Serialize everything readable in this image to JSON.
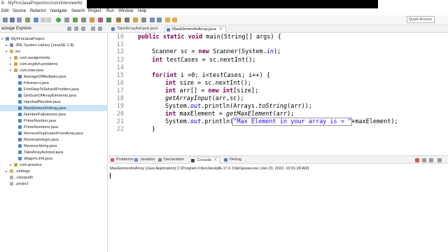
{
  "window": {
    "title": "B - MyFirstJavaProject/src/com/interview/M"
  },
  "menu": [
    "Edit",
    "Source",
    "Refactor",
    "Navigate",
    "Search",
    "Project",
    "Run",
    "Window",
    "Help"
  ],
  "toolbar": {
    "quick_access": "Quick Access"
  },
  "package_explorer": {
    "title": "ackage Explorer",
    "items": [
      {
        "label": "MyFirstJavaProject",
        "icon": "project-icon",
        "level": 0,
        "expanded": true
      },
      {
        "label": "JRE System Library [JavaSE-1.8]",
        "icon": "library-icon",
        "level": 1,
        "expanded": false
      },
      {
        "label": "src",
        "icon": "folder-icon",
        "level": 1,
        "expanded": true
      },
      {
        "label": "com.assignments",
        "icon": "package-icon",
        "level": 2,
        "expanded": false
      },
      {
        "label": "com.english.problems",
        "icon": "package-icon",
        "level": 2,
        "expanded": false
      },
      {
        "label": "com.interview",
        "icon": "package-icon",
        "level": 2,
        "expanded": true
      },
      {
        "label": "AverageOfMultiples.java",
        "icon": "java-file-icon",
        "level": 3
      },
      {
        "label": "Fibonacci.java",
        "icon": "java-file-icon",
        "level": 3
      },
      {
        "label": "FirstStepToSolveAProblem.java",
        "icon": "java-file-icon",
        "level": 3
      },
      {
        "label": "GetSumOfArrayElements.java",
        "icon": "java-file-icon",
        "level": 3
      },
      {
        "label": "HarshadNumber.java",
        "icon": "java-file-icon",
        "level": 3
      },
      {
        "label": "MaxElementInArray.java",
        "icon": "java-file-icon",
        "level": 3,
        "selected": true
      },
      {
        "label": "NumberPalindrome.java",
        "icon": "java-file-icon",
        "level": 3
      },
      {
        "label": "PrimeNumber.java",
        "icon": "java-file-icon",
        "level": 3
      },
      {
        "label": "PrimeNumbers.java",
        "icon": "java-file-icon",
        "level": 3
      },
      {
        "label": "RemoveDuplicatesFromArray.java",
        "icon": "java-file-icon",
        "level": 3
      },
      {
        "label": "ReverseInteger.java",
        "icon": "java-file-icon",
        "level": 3
      },
      {
        "label": "ReverseString.java",
        "icon": "java-file-icon",
        "level": 3
      },
      {
        "label": "TakeArrayAsInput.java",
        "icon": "java-file-icon",
        "level": 3
      },
      {
        "label": "WagonLimit.java",
        "icon": "java-file-icon",
        "level": 3
      },
      {
        "label": "com.practice",
        "icon": "package-icon",
        "level": 2,
        "expanded": false
      },
      {
        "label": ".settings",
        "icon": "folder-icon",
        "level": 1,
        "expanded": false
      },
      {
        "label": ".classpath",
        "icon": "file-icon",
        "level": 1
      },
      {
        "label": ".project",
        "icon": "file-icon",
        "level": 1
      }
    ]
  },
  "editor": {
    "tabs": [
      {
        "label": "TakeArrayAsInput.java",
        "active": false
      },
      {
        "label": "MaxElementInArray.java",
        "active": true
      }
    ],
    "line_numbers": [
      "10",
      "11",
      "12",
      "13",
      "14",
      "15",
      "16",
      "17",
      "18",
      "19",
      "20",
      "21",
      "22"
    ]
  },
  "console": {
    "tabs": [
      {
        "label": "Problems",
        "active": false,
        "color": "#d9534f"
      },
      {
        "label": "Javadoc",
        "active": false,
        "color": "#6a8fc4"
      },
      {
        "label": "Declaration",
        "active": false,
        "color": "#7a9a5a"
      },
      {
        "label": "Console",
        "active": true,
        "color": "#444444"
      },
      {
        "label": "Debug",
        "active": false,
        "color": "#5a7fb0"
      }
    ],
    "status": "MaxElementInArray [Java Application] C:\\Program Files\\Java\\jdk-17.0.1\\bin\\javaw.exe (Jan 23, 2022, 10:01:28 AM)"
  }
}
